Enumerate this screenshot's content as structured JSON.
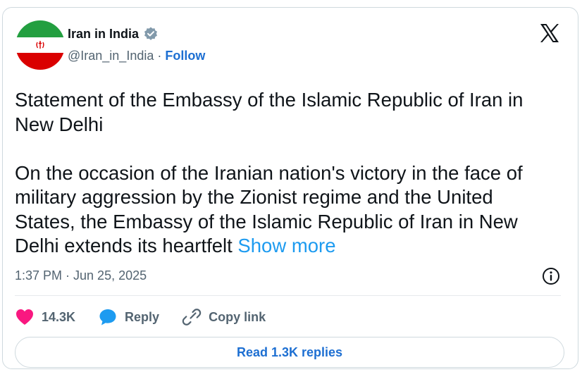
{
  "author": {
    "display_name": "Iran in India",
    "handle": "@Iran_in_India",
    "separator": "·",
    "follow_label": "Follow"
  },
  "tweet": {
    "paragraph1": "Statement of the Embassy of the Islamic Republic of Iran in New Delhi",
    "paragraph2": "On the occasion of the Iranian nation's victory in the face of military aggression by the Zionist regime and the United States, the Embassy of the Islamic Republic of Iran in New Delhi extends its heartfelt",
    "show_more": "Show more",
    "timestamp": "1:37 PM · Jun 25, 2025"
  },
  "actions": {
    "like_count": "14.3K",
    "reply_label": "Reply",
    "copy_link_label": "Copy link"
  },
  "replies_button": "Read 1.3K replies",
  "icons": {
    "avatar": "iran-flag",
    "verified": "verified-badge-icon",
    "logo": "x-logo-icon",
    "info": "info-icon",
    "like": "heart-icon",
    "reply": "speech-bubble-icon",
    "link": "link-icon"
  },
  "colors": {
    "link_blue": "#1d6fd2",
    "show_more_blue": "#1d9bf0",
    "like_pink": "#f91880",
    "reply_blue": "#1d9bf0",
    "muted": "#536471",
    "verified_grey": "#829aab"
  }
}
